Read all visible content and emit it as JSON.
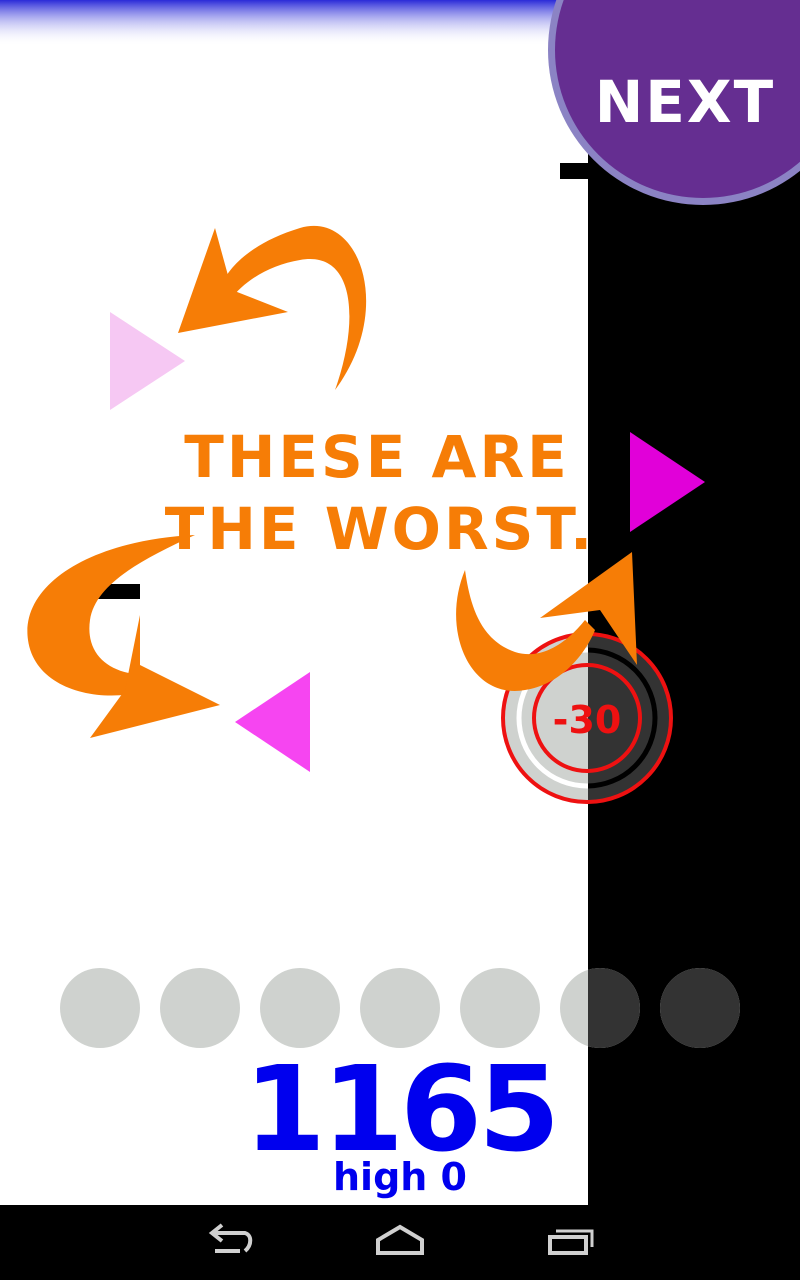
{
  "next_button": {
    "label": "NEXT",
    "color": "#652e91",
    "ring_color": "#8b83c4"
  },
  "hint": {
    "line1": "THESE ARE",
    "line2": "THE WORST.",
    "color": "#f67d06"
  },
  "penalty": {
    "label": "-30",
    "color": "#ee1111"
  },
  "lives": {
    "total": 7,
    "active": 7,
    "color": "#cfd2cf"
  },
  "score": {
    "value": "1165",
    "color": "#0000ee"
  },
  "high": {
    "label": "high 0",
    "color": "#0000ee"
  },
  "colors": {
    "top_bar": "#2a2ad8",
    "dark_side": "#000000",
    "triangle_pale": "#f6c8f3",
    "triangle_mid": "#f645f1",
    "triangle_dark_side": "#e100d9",
    "arrow": "#f67d06"
  },
  "nav": {
    "back": "back-icon",
    "home": "home-icon",
    "recents": "recents-icon"
  }
}
